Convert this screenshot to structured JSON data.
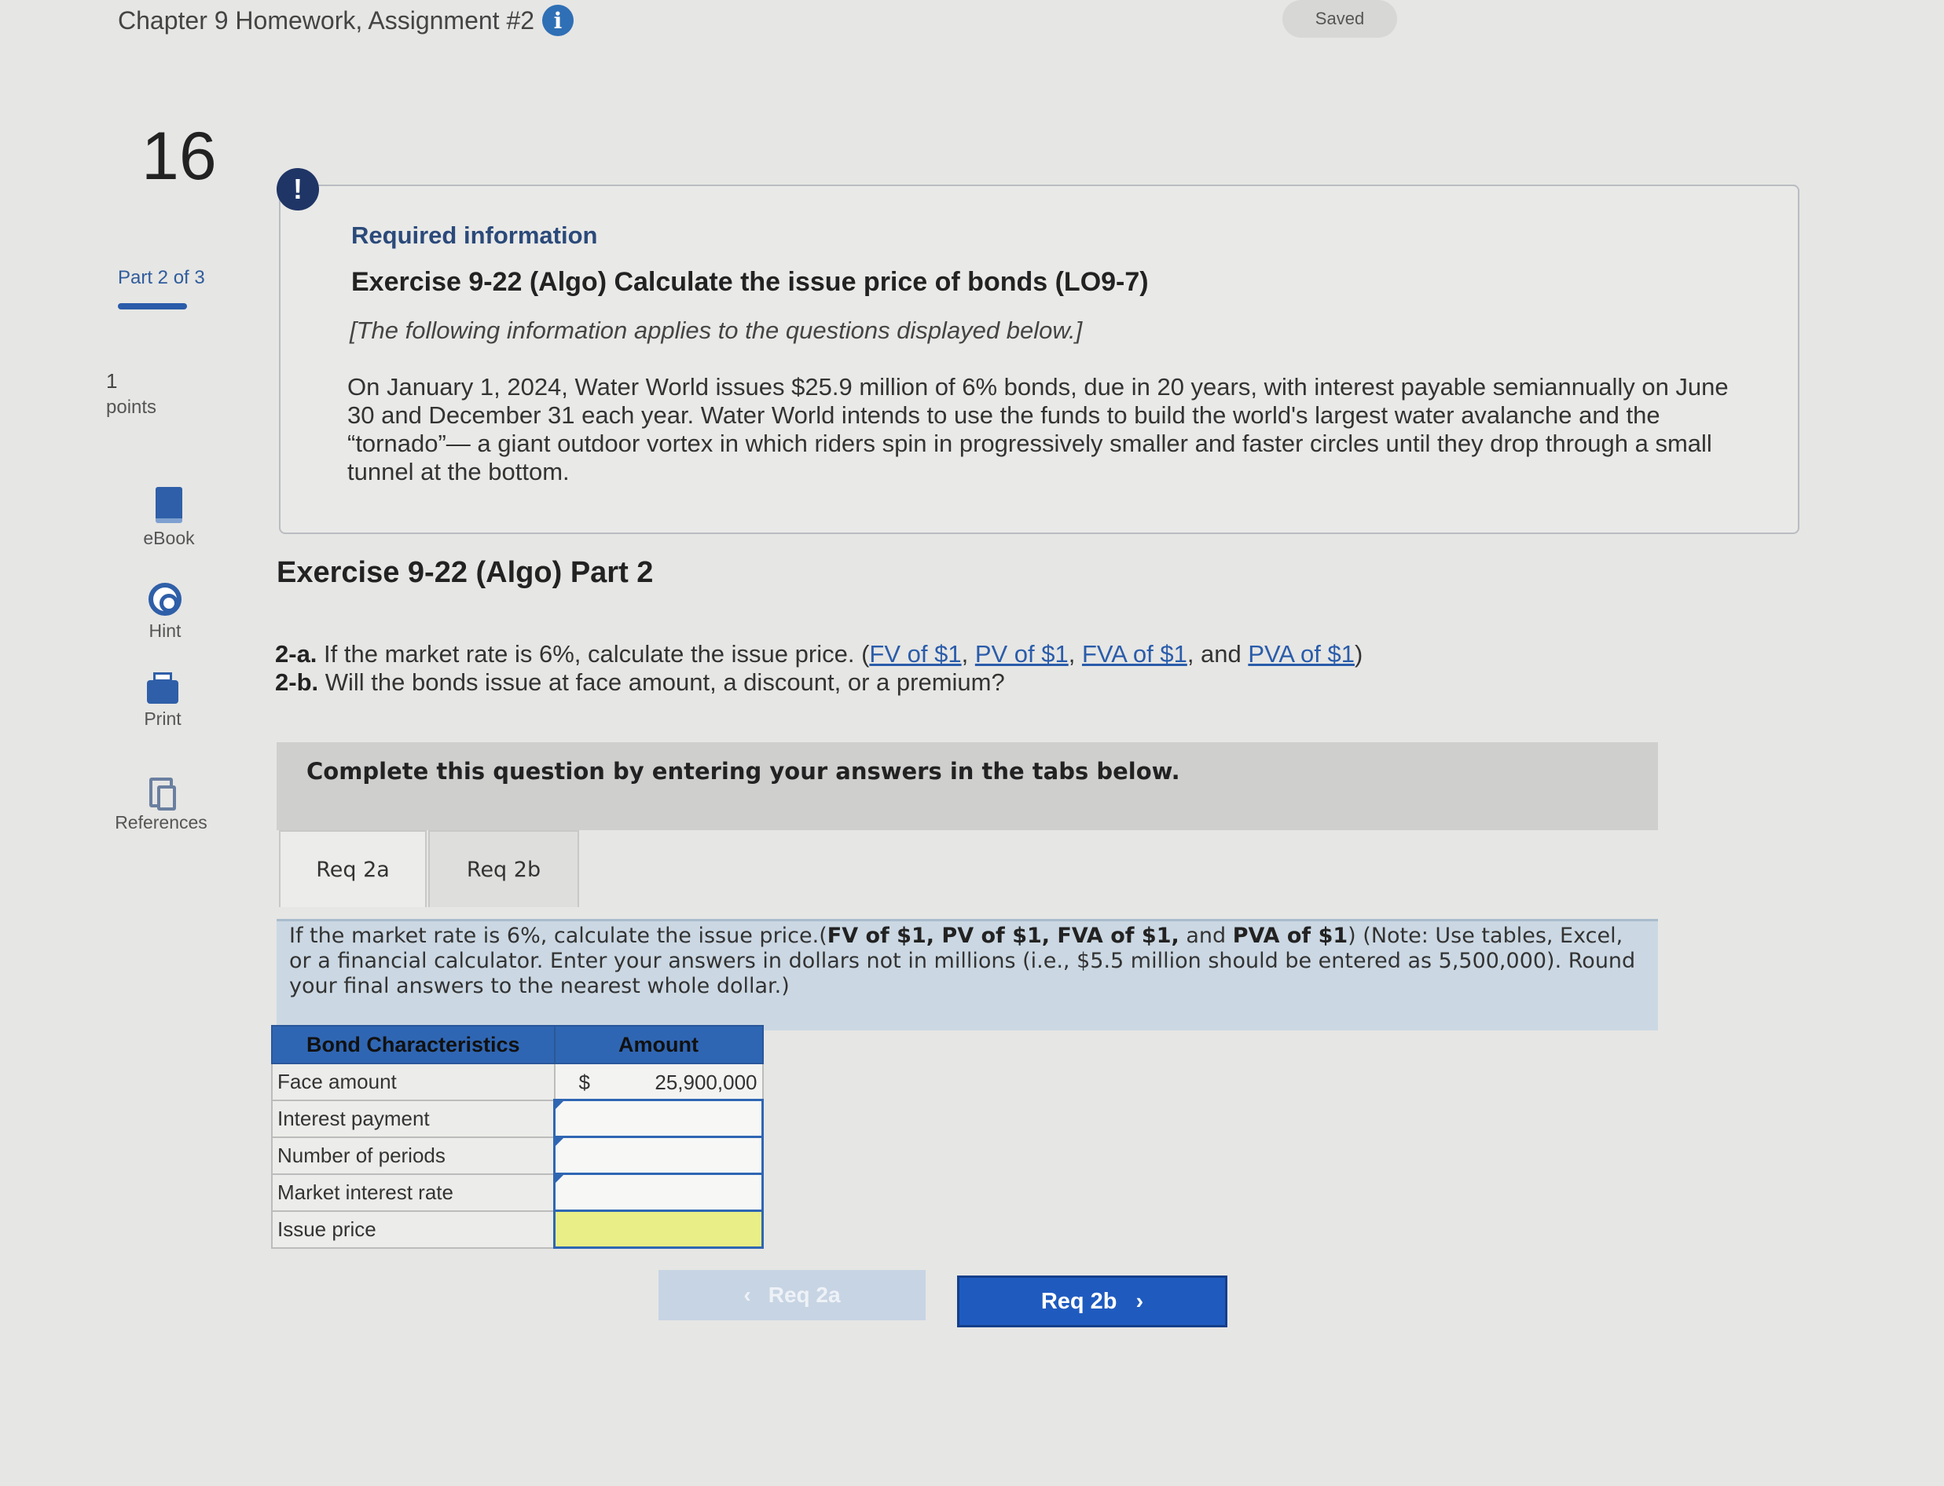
{
  "header": {
    "assignment_title": "Chapter 9 Homework, Assignment #2",
    "info_glyph": "i",
    "saved_label": "Saved"
  },
  "rail": {
    "question_number": "16",
    "part_prefix": "Part 2",
    "part_suffix": " of 3",
    "points_value": "1",
    "points_label": "points",
    "tools": {
      "ebook": "eBook",
      "hint": "Hint",
      "print": "Print",
      "references": "References"
    }
  },
  "required": {
    "alert_glyph": "!",
    "heading": "Required information",
    "exercise_title": "Exercise 9-22 (Algo) Calculate the issue price of bonds (LO9-7)",
    "note": "[The following information applies to the questions displayed below.]",
    "scenario": "On January 1, 2024, Water World issues $25.9 million of 6% bonds, due in 20 years, with interest payable semiannually on June 30 and December 31 each year. Water World intends to use the funds to build the world's largest water avalanche and the “tornado”— a giant outdoor vortex in which riders spin in progressively smaller and faster circles until they drop through a small tunnel at the bottom."
  },
  "part": {
    "title": "Exercise 9-22 (Algo) Part 2",
    "q2a_tag": "2-a.",
    "q2a_text": " If the market rate is 6%, calculate the issue price. (",
    "link_fv": "FV of $1",
    "link_pv": "PV of $1",
    "link_fva": "FVA of $1",
    "link_pva": "PVA of $1",
    "sep1": ", ",
    "sep2": ", ",
    "sep3": ", and ",
    "close": ")",
    "q2b_tag": "2-b.",
    "q2b_text": " Will the bonds issue at face amount, a discount, or a premium?"
  },
  "instructions": {
    "complete_text": "Complete this question by entering your answers in the tabs below."
  },
  "tabs": [
    {
      "label": "Req 2a",
      "active": true
    },
    {
      "label": "Req 2b",
      "active": false
    }
  ],
  "panel": {
    "lead": "If the market rate is 6%, calculate the issue price.(",
    "bold_refs": "FV of $1, PV of $1, FVA of $1,",
    "and": " and ",
    "bold_pva": "PVA of $1",
    "close": ")",
    "note": " (Note: Use tables, Excel, or a financial calculator. Enter your answers in dollars not in millions (i.e., $5.5 million should be entered as 5,500,000). Round your final answers to the nearest whole dollar.)"
  },
  "table": {
    "col_label": "Bond Characteristics",
    "col_amount": "Amount",
    "rows": [
      {
        "label": "Face amount",
        "currency": "$",
        "value": "25,900,000"
      },
      {
        "label": "Interest payment",
        "currency": "",
        "value": ""
      },
      {
        "label": "Number of periods",
        "currency": "",
        "value": ""
      },
      {
        "label": "Market interest rate",
        "currency": "",
        "value": ""
      },
      {
        "label": "Issue price",
        "currency": "",
        "value": ""
      }
    ]
  },
  "nav": {
    "prev_label": "Req 2a",
    "next_label": "Req 2b",
    "prev_glyph": "‹",
    "next_glyph": "›"
  },
  "colors": {
    "accent": "#2f66b3",
    "button_primary": "#1f5bbf",
    "highlight_cell": "#e9ee86"
  }
}
